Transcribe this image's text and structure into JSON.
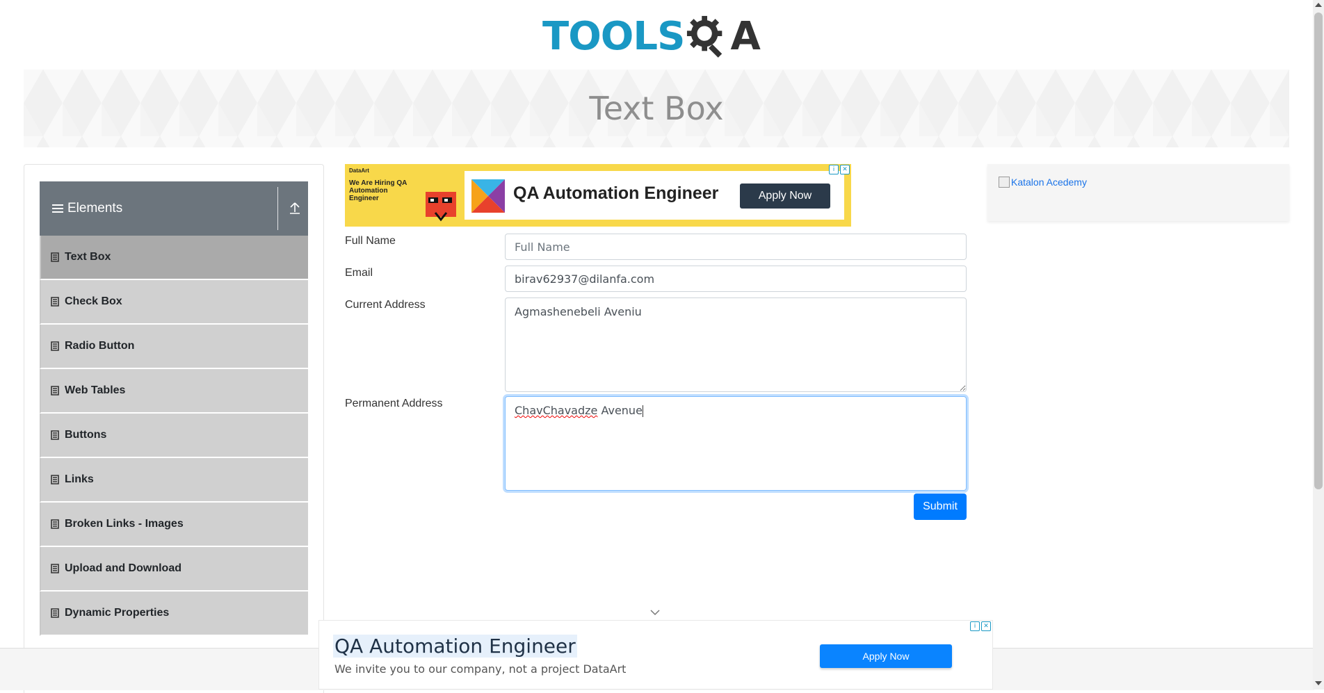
{
  "header": {
    "logo_tools": "TOOLS",
    "logo_qa_q": "Q",
    "logo_qa_a": "A",
    "logo_color_primary": "#1a98c4",
    "logo_color_secondary": "#333333"
  },
  "banner": {
    "title": "Text Box"
  },
  "sidebar": {
    "group_title": "Elements",
    "group_bg": "#6c757d",
    "items": [
      {
        "label": "Text Box",
        "active": true,
        "icon": "file-icon"
      },
      {
        "label": "Check Box",
        "active": false,
        "icon": "file-icon"
      },
      {
        "label": "Radio Button",
        "active": false,
        "icon": "file-icon"
      },
      {
        "label": "Web Tables",
        "active": false,
        "icon": "file-icon"
      },
      {
        "label": "Buttons",
        "active": false,
        "icon": "file-icon"
      },
      {
        "label": "Links",
        "active": false,
        "icon": "file-icon"
      },
      {
        "label": "Broken Links - Images",
        "active": false,
        "icon": "file-icon"
      },
      {
        "label": "Upload and Download",
        "active": false,
        "icon": "file-icon"
      },
      {
        "label": "Dynamic Properties",
        "active": false,
        "icon": "file-icon"
      }
    ]
  },
  "ad_top": {
    "brand": "DataArt",
    "hiring": "We Are Hiring QA Automation Engineer",
    "title": "QA Automation Engineer",
    "button": "Apply Now"
  },
  "form": {
    "full_name_label": "Full Name",
    "full_name_placeholder": "Full Name",
    "full_name_value": "",
    "email_label": "Email",
    "email_value": "birav62937@dilanfa.com",
    "current_address_label": "Current Address",
    "current_address_value": "Agmashenebeli Aveniu",
    "permanent_address_label": "Permanent Address",
    "permanent_address_word1": "ChavChavadze",
    "permanent_address_word2": " Avenue",
    "submit_label": "Submit"
  },
  "ad_right": {
    "alt_text": "Katalon Acedemy"
  },
  "ad_bottom": {
    "title": "QA Automation Engineer",
    "subtitle": "We invite you to our company, not a project DataArt",
    "button": "Apply Now"
  }
}
